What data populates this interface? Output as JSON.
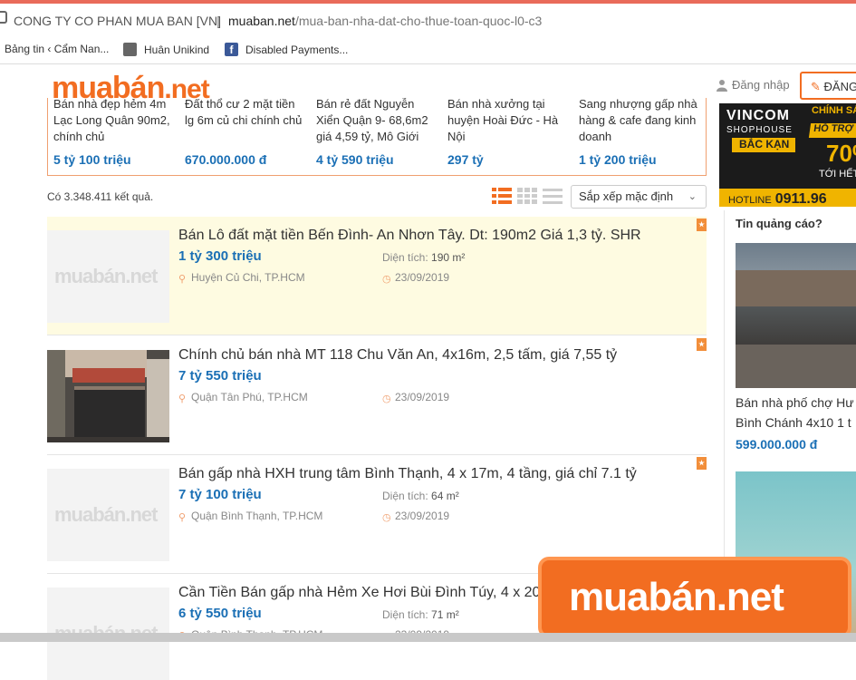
{
  "browser": {
    "site_name": "CONG TY CO PHAN MUA BAN [VN]",
    "separator": "|",
    "url_domain": "muaban.net",
    "url_path": "/mua-ban-nha-dat-cho-thue-toan-quoc-l0-c3"
  },
  "bookmarks": [
    {
      "label": "Bảng tin ‹ Cẩm Nan...",
      "icon": "wordpress-icon",
      "color": "#888888"
    },
    {
      "label": "Huân Unikind",
      "icon": "bookmark-page-icon",
      "color": "#555555"
    },
    {
      "label": "Disabled Payments...",
      "icon": "facebook-icon",
      "color": "#3b5998"
    }
  ],
  "header": {
    "logo_main": "muabán",
    "logo_tld": ".net",
    "login_label": "Đăng nhập",
    "post_label": "ĐĂNG"
  },
  "featured": [
    {
      "title": "Bán nhà đẹp hẻm 4m Lạc Long Quân 90m2, chính chủ",
      "price": "5 tỷ 100 triệu"
    },
    {
      "title": "Đất thổ cư 2 mặt tiền lg 6m củ chi chính chủ",
      "price": "670.000.000 đ"
    },
    {
      "title": "Bán rẻ đất Nguyễn Xiển Quận 9- 68,6m2 giá 4,59 tỷ, Mô Giới",
      "price": "4 tỷ 590 triệu"
    },
    {
      "title": "Bán nhà xưởng tại huyện Hoài Đức - Hà Nội",
      "price": "297 tỷ"
    },
    {
      "title": "Sang nhượng gấp nhà hàng & cafe đang kinh doanh",
      "price": "1 tỷ 200 triệu"
    }
  ],
  "results": {
    "count_text": "Có 3.348.411 kết quả.",
    "sort_label": "Sắp xếp mặc định",
    "view_modes": [
      "list-view-icon",
      "grid-view-icon",
      "compact-view-icon"
    ]
  },
  "listings": [
    {
      "title": "Bán Lô đất mặt tiền Bến Đình- An Nhơn Tây. Dt: 190m2 Giá 1,3 tỷ. SHR",
      "price": "1 tỷ 300 triệu",
      "area_label": "Diện tích:",
      "area": "190 m²",
      "location": "Huyện Củ Chi, TP.HCM",
      "date": "23/09/2019",
      "highlighted": true,
      "thumb_watermark": "muabán.net"
    },
    {
      "title": "Chính chủ bán nhà MT 118 Chu Văn An, 4x16m, 2,5 tấm, giá 7,55 tỷ",
      "price": "7 tỷ 550 triệu",
      "area_label": "",
      "area": "",
      "location": "Quận Tân Phú, TP.HCM",
      "date": "23/09/2019",
      "highlighted": false,
      "thumb_watermark": ""
    },
    {
      "title": "Bán gấp nhà HXH trung tâm Bình Thạnh, 4 x 17m, 4 tầng, giá chỉ 7.1 tỷ",
      "price": "7 tỷ 100 triệu",
      "area_label": "Diện tích:",
      "area": "64 m²",
      "location": "Quận Bình Thạnh, TP.HCM",
      "date": "23/09/2019",
      "highlighted": false,
      "thumb_watermark": "muabán.net"
    },
    {
      "title": "Cần Tiền Bán gấp nhà Hẻm Xe Hơi Bùi Đình Túy, 4 x 20",
      "price": "6 tỷ 550 triệu",
      "area_label": "Diện tích:",
      "area": "71 m²",
      "location": "Quận Bình Thạnh, TP.HCM",
      "date": "23/09/2019",
      "highlighted": false,
      "thumb_watermark": "muabán.net"
    }
  ],
  "ad_banner": {
    "brand": "VINCOM",
    "brand_sub": "SHOPHOUSE",
    "location": "BẮC KẠN",
    "headline": "CHÍNH SÁ",
    "support": "HỖ TRỢ V",
    "percent": "70%",
    "until": "TỚI HẾT",
    "hotline_label": "HOTLINE",
    "hotline_number": "0911.96"
  },
  "sidebar": {
    "heading": "Tin quảng cáo?",
    "ad1_title_line1": "Bán nhà phố chợ Hư",
    "ad1_title_line2": "Bình Chánh 4x10 1 t",
    "ad1_price": "599.000.000 đ"
  },
  "overlay_logo": "muabán.net",
  "colors": {
    "brand_orange": "#f26d21",
    "price_blue": "#1a6fb5",
    "highlight_bg": "#fefbe1"
  }
}
